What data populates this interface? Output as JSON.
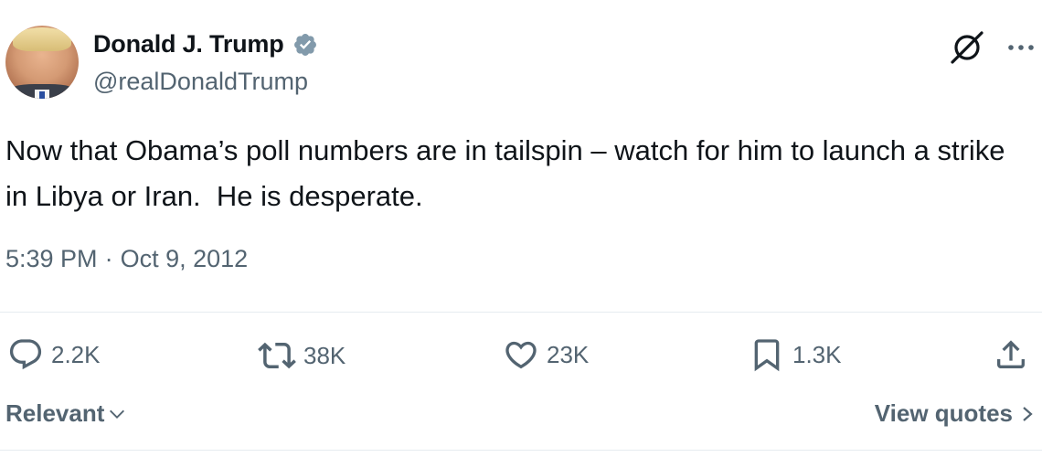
{
  "author": {
    "display_name": "Donald J. Trump",
    "handle": "@realDonaldTrump",
    "verified": true,
    "verified_color": "#829aab"
  },
  "tweet": {
    "text": "Now that Obama’s poll numbers are in tailspin – watch for him to launch a strike in Libya or Iran.  He is desperate.",
    "time": "5:39 PM",
    "separator": "·",
    "date": "Oct 9, 2012"
  },
  "actions": {
    "reply_count": "2.2K",
    "repost_count": "38K",
    "like_count": "23K",
    "bookmark_count": "1.3K"
  },
  "icons": {
    "top": [
      "grok-icon",
      "more-icon"
    ],
    "actions": [
      "reply-icon",
      "repost-icon",
      "like-icon",
      "bookmark-icon",
      "share-icon"
    ]
  },
  "footer": {
    "sort_label": "Relevant",
    "view_quotes_label": "View quotes"
  },
  "colors": {
    "text_primary": "#0f1419",
    "text_secondary": "#536471",
    "divider": "#e6ecf0"
  }
}
